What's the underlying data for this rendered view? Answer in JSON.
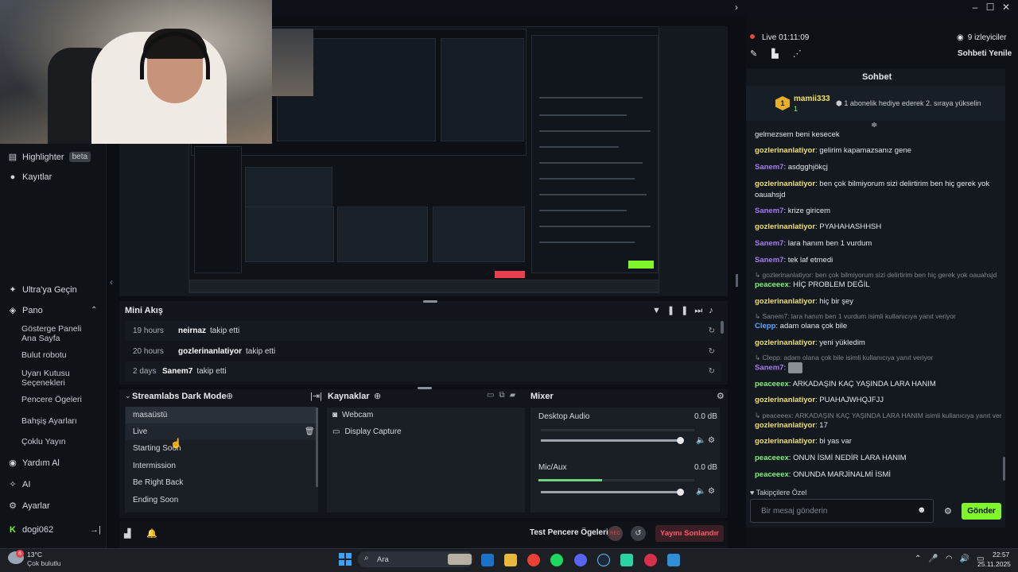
{
  "sidebar": {
    "highlighter": "Highlighter",
    "beta": "beta",
    "recordings": "Kayıtlar",
    "ultra": "Ultra'ya Geçin",
    "dashboard": "Pano",
    "sub_items": [
      "Gösterge Paneli Ana Sayfa",
      "Bulut robotu",
      "Uyarı Kutusu Seçenekleri",
      "Pencere Ögeleri",
      "Bahşiş Ayarları",
      "Çoklu Yayın"
    ],
    "help": "Yardım Al",
    "ai": "AI",
    "settings": "Ayarlar",
    "user": "dogi062"
  },
  "minifeed": {
    "title": "Mini Akış",
    "rows": [
      {
        "time": "19 hours",
        "user": "neirnaz",
        "action": "takip etti"
      },
      {
        "time": "20 hours",
        "user": "gozlerinanlatiyor",
        "action": "takip etti"
      },
      {
        "time": "2 days",
        "user": "Sanem7",
        "action": "takip etti"
      }
    ]
  },
  "scenes": {
    "title": "Streamlabs Dark Mode",
    "items": [
      "masaüstü",
      "Live",
      "Starting Soon",
      "Intermission",
      "Be Right Back",
      "Ending Soon"
    ]
  },
  "sources": {
    "title": "Kaynaklar",
    "items": [
      "Webcam",
      "Display Capture"
    ]
  },
  "mixer": {
    "title": "Mixer",
    "channels": [
      {
        "name": "Desktop Audio",
        "db": "0.0 dB"
      },
      {
        "name": "Mic/Aux",
        "db": "0.0 dB"
      }
    ]
  },
  "footer": {
    "test_widgets": "Test Pencere Ögeleri",
    "rec": "REC",
    "end_stream": "Yayını Sonlandır"
  },
  "chat": {
    "live": "Live",
    "timer": "01:11:09",
    "viewers": "9 izleyiciler",
    "refresh": "Sohbeti Yenile",
    "title": "Sohbet",
    "top_user": "mamii333",
    "top_rank": "1",
    "top_sub": "1",
    "top_msg": "1 abonelik hediye ederek 2. sıraya yükselin",
    "followers_only": "Takipçilere Özel",
    "placeholder": "Bir mesaj gönderin",
    "send": "Gönder",
    "messages": [
      {
        "user": "",
        "text": "gelmezsem beni kesecek"
      },
      {
        "user": "gozlerinanlatiyor",
        "text": "gelirim kapamazsanız gene"
      },
      {
        "user": "Sanem7",
        "text": "asdgghjökçj"
      },
      {
        "user": "gozlerinanlatiyor",
        "text": "ben çok bilmiyorum sizi delirtirim ben hiç gerek yok oauahsjd"
      },
      {
        "user": "Sanem7",
        "text": "krize giricem"
      },
      {
        "user": "gozlerinanlatiyor",
        "text": "PYAHAHASHHSH"
      },
      {
        "user": "Sanem7",
        "text": "lara hanım ben 1 vurdum"
      },
      {
        "user": "Sanem7",
        "text": "tek laf etmedi"
      },
      {
        "reply": "gozlerinanlatiyor: ben çok bilmiyorum sizi delirtirim ben hiç gerek yok oauahsjd"
      },
      {
        "user": "peaceeex",
        "text": "HİÇ PROBLEM DEĞİL"
      },
      {
        "user": "gozlerinanlatiyor",
        "text": "hiç bir şey"
      },
      {
        "reply": "Sanem7: lara hanım ben 1 vurdum isimli kullanıcıya yanıt veriyor"
      },
      {
        "user": "Clepp",
        "text": "adam olana çok bile"
      },
      {
        "user": "gozlerinanlatiyor",
        "text": "yeni yükledim"
      },
      {
        "reply": "Clepp: adam olana çok bile isimli kullanıcıya yanıt veriyor"
      },
      {
        "user": "Sanem7",
        "text": ""
      },
      {
        "user": "peaceeex",
        "text": "ARKADAŞIN KAÇ YAŞINDA LARA HANIM"
      },
      {
        "user": "gozlerinanlatiyor",
        "text": "PUAHAJWHQJFJJ"
      },
      {
        "reply": "peaceeex: ARKADAŞIN KAÇ YAŞINDA LARA HANIM isimli kullanıcıya yanıt veriyor"
      },
      {
        "user": "gozlerinanlatiyor",
        "text": "17"
      },
      {
        "user": "gozlerinanlatiyor",
        "text": "bi yas var"
      },
      {
        "user": "peaceeex",
        "text": "ONUN İSMİ NEDİR LARA HANIM"
      },
      {
        "user": "peaceeex",
        "text": "ONUNDA MARJİNALMİ İSMİ"
      }
    ]
  },
  "taskbar": {
    "weather_temp": "13°C",
    "weather_desc": "Çok bulutlu",
    "weather_badge": "6",
    "search": "Ara",
    "time": "22:57",
    "date": "25.11.2025"
  },
  "colors": {
    "accent_green": "#80f52b",
    "end_red": "#e8404f",
    "live_red": "#e84343"
  }
}
